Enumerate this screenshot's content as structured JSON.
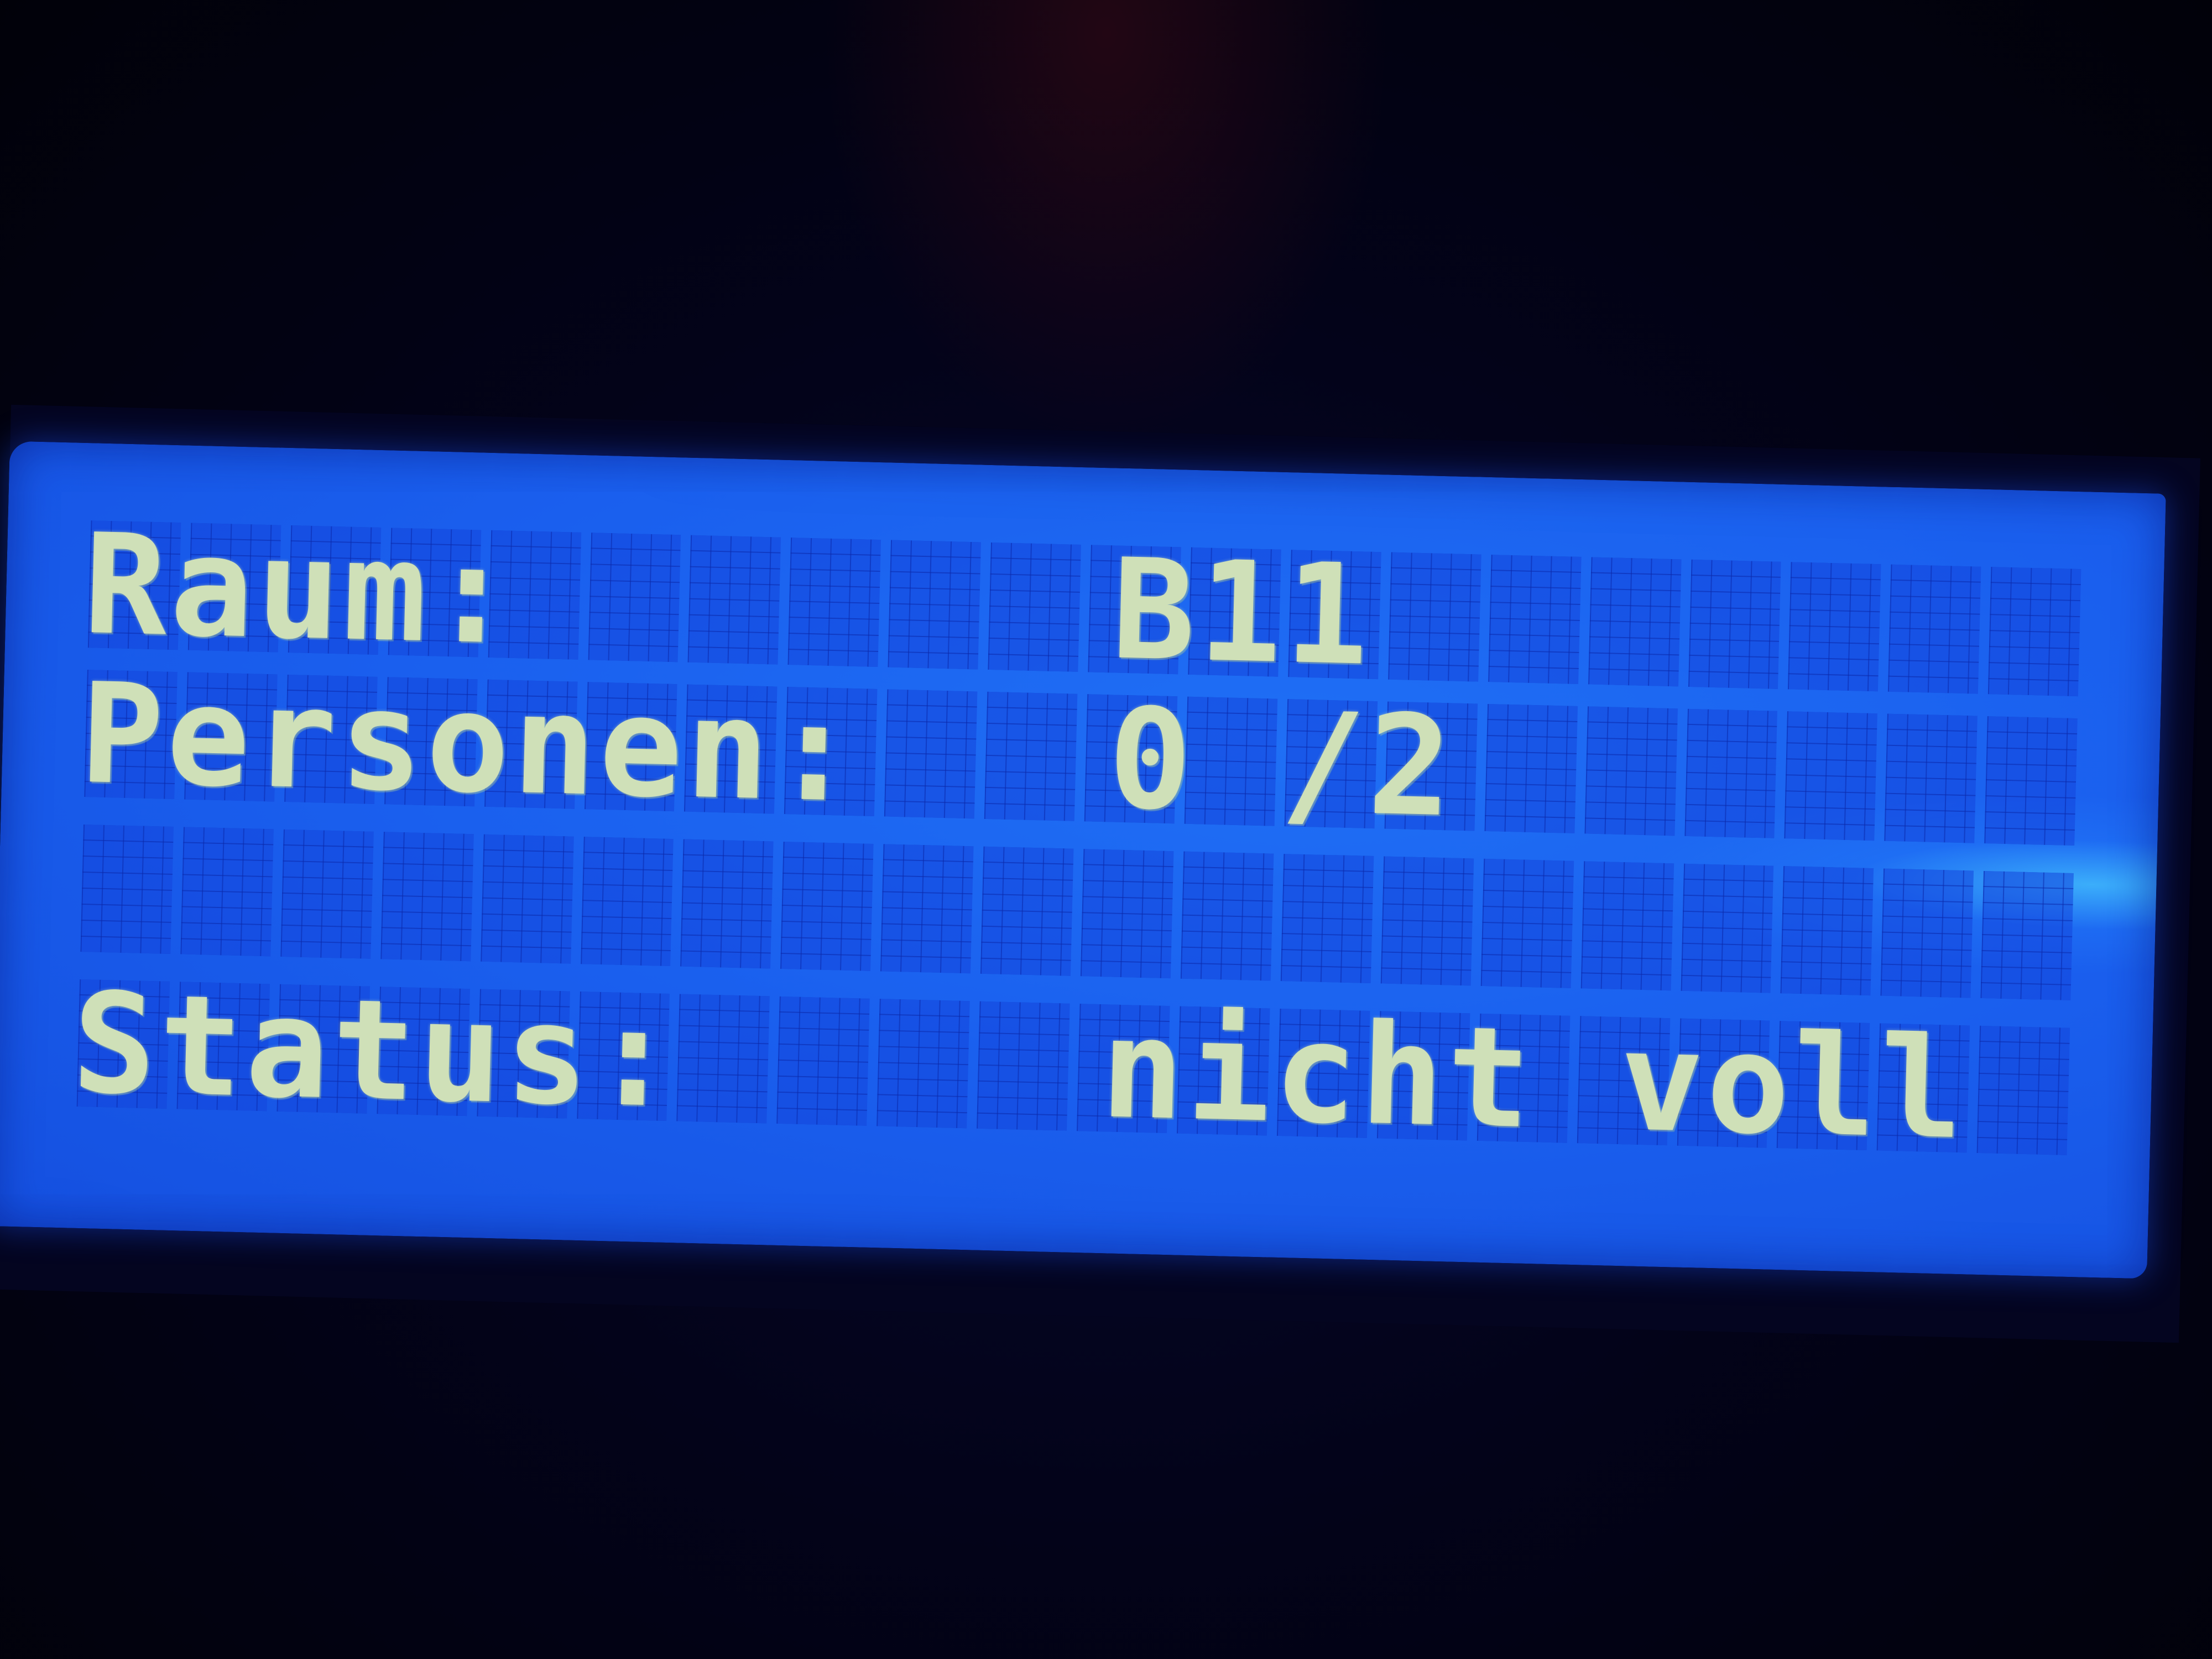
{
  "display": {
    "row1": {
      "label": "Raum:",
      "value": "B11"
    },
    "row2": {
      "label": "Personen:",
      "value": "0 /2"
    },
    "row3": {
      "label": "",
      "value": ""
    },
    "row4": {
      "label": "Status:",
      "value": "nicht voll"
    },
    "colors": {
      "backlight": "#1a5fee",
      "pixels": "#cfe0b8",
      "housing": "#02020e"
    }
  }
}
